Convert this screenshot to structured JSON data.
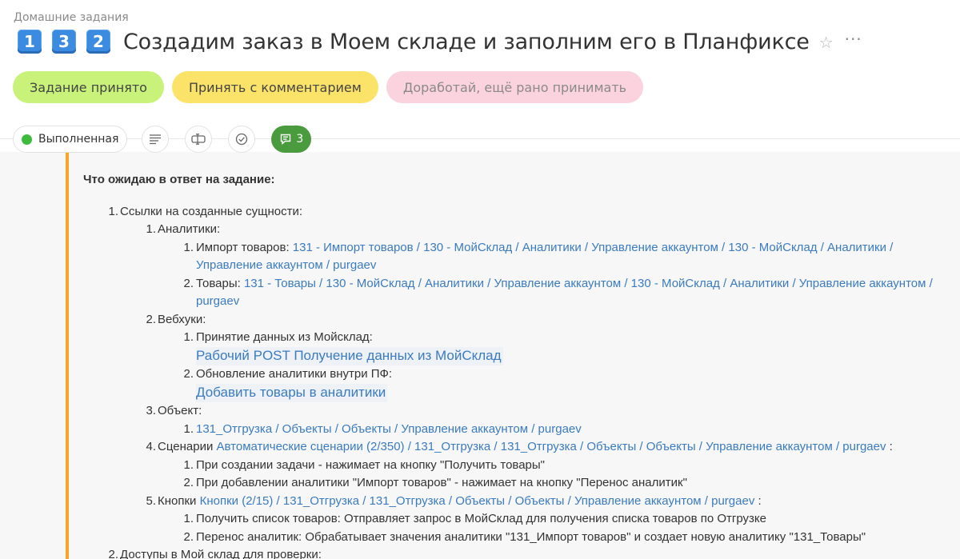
{
  "breadcrumb": "Домашние задания",
  "title": {
    "keys": [
      "1",
      "3",
      "2"
    ],
    "text": "Создадим заказ в Моем складе и заполним его в Планфиксе"
  },
  "actions": {
    "accept": "Задание принято",
    "comment": "Принять с комментарием",
    "rework": "Доработай, ещё рано принимать"
  },
  "status": {
    "label": "Выполненная",
    "color": "#3dbb3d"
  },
  "toolbar": {
    "comments_count": "3"
  },
  "doc": {
    "heading": "Что ожидаю в ответ на задание:",
    "item1": {
      "num": "1.",
      "text": "Ссылки на созданные сущности:",
      "analytics": {
        "num": "1.",
        "text": "Аналитики:",
        "import": {
          "num": "1.",
          "label": "Импорт товаров: ",
          "link": "131 - Импорт товаров / 130 - МойСклад / Аналитики / Управление аккаунтом / 130 - МойСклад / Аналитики / Управление аккаунтом / purgaev"
        },
        "goods": {
          "num": "2.",
          "label": "Товары: ",
          "link": "131 - Товары / 130 - МойСклад / Аналитики / Управление аккаунтом / 130 - МойСклад / Аналитики / Управление аккаунтом / purgaev"
        }
      },
      "webhooks": {
        "num": "2.",
        "text": "Вебхуки:",
        "receive": {
          "num": "1.",
          "label": "Принятие данных из Мойсклад:",
          "link": "Рабочий POST Получение данных из МойСклад"
        },
        "update": {
          "num": "2.",
          "label": "Обновление аналитики внутри ПФ:",
          "link": "Добавить товары в аналитики"
        }
      },
      "object": {
        "num": "3.",
        "text": "Объект:",
        "item": {
          "num": "1.",
          "link": "131_Отгрузка / Объекты / Объекты / Управление аккаунтом / purgaev"
        }
      },
      "scenarios": {
        "num": "4.",
        "label": "Сценарии ",
        "link": "Автоматические сценарии (2/350) / 131_Отгрузка / 131_Отгрузка / Объекты / Объекты / Управление аккаунтом / purgaev",
        "suffix": " :",
        "s1": {
          "num": "1.",
          "text": "При создании задачи - нажимает на кнопку \"Получить товары\""
        },
        "s2": {
          "num": "2.",
          "text": "При добавлении аналитики \"Импорт товаров\" - нажимает на кнопку \"Перенос аналитик\""
        }
      },
      "buttons": {
        "num": "5.",
        "label": "Кнопки ",
        "link": "Кнопки  (2/15) / 131_Отгрузка / 131_Отгрузка / Объекты / Объекты / Управление аккаунтом / purgaev",
        "suffix": " :",
        "b1": {
          "num": "1.",
          "text": "Получить список товаров: Отправляет запрос в МойСклад для получения списка товаров по Отгрузке"
        },
        "b2": {
          "num": "2.",
          "text": "Перенос аналитик: Обрабатывает значения аналитики \"131_Импорт товаров\" и создает новую аналитику \"131_Товары\""
        }
      }
    },
    "item2": {
      "num": "2.",
      "text": "Доступы в Мой склад для проверки:"
    }
  },
  "colors": {
    "accent": "#f5a623",
    "link": "#3b7bbf",
    "accept": "#c9f27a",
    "comment": "#fbe36a",
    "rework": "#fbd3df",
    "comments_badge": "#4a9a3e"
  },
  "icons": [
    "star-icon",
    "more-icon",
    "description-icon",
    "fields-icon",
    "checklist-icon",
    "comment-icon"
  ]
}
